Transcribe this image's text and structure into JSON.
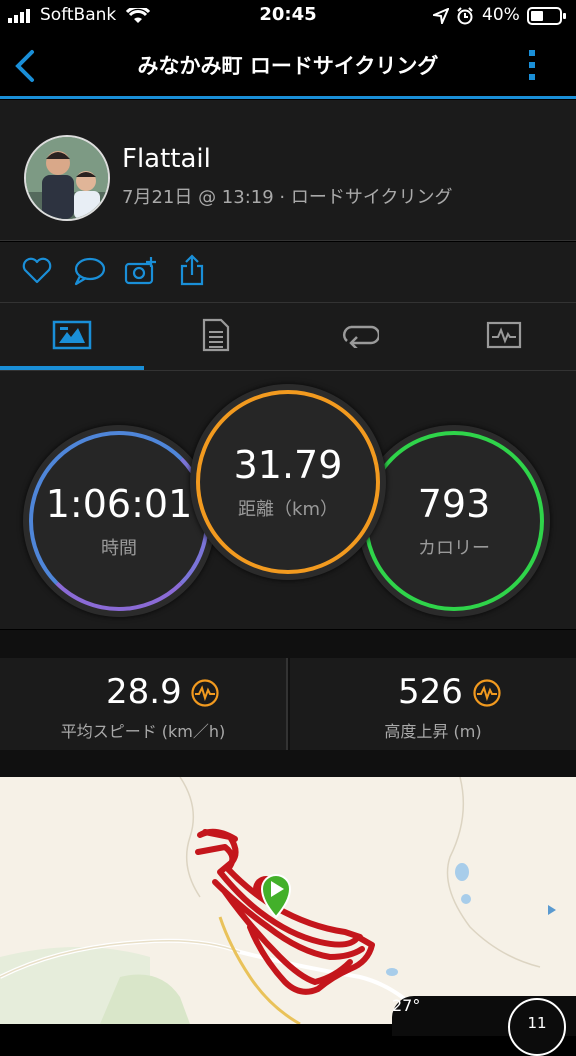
{
  "status_bar": {
    "carrier": "SoftBank",
    "time": "20:45",
    "battery": "40%"
  },
  "nav": {
    "title": "みなかみ町 ロードサイクリング"
  },
  "activity": {
    "user_name": "Flattail",
    "subtitle": "7月21日 @ 13:19 · ロードサイクリング"
  },
  "tabs": [
    "overview-icon",
    "details-icon",
    "laps-icon",
    "charts-icon"
  ],
  "stats": {
    "time": {
      "value": "1:06:01",
      "label": "時間",
      "color": "#4f86d9"
    },
    "distance": {
      "value": "31.79",
      "label": "距離（km）",
      "color": "#f29a1f"
    },
    "calories": {
      "value": "793",
      "label": "カロリー",
      "color": "#2fd44a"
    }
  },
  "metrics": [
    {
      "value": "28.9",
      "label": "平均スピード (km／h)"
    },
    {
      "value": "526",
      "label": "高度上昇 (m)"
    }
  ],
  "weather": {
    "temp": "27°",
    "badge": "11"
  },
  "colors": {
    "accent": "#1a8fd8",
    "route": "#c4161c",
    "start_marker": "#43b02a",
    "metric_badge": "#f29a1f"
  }
}
